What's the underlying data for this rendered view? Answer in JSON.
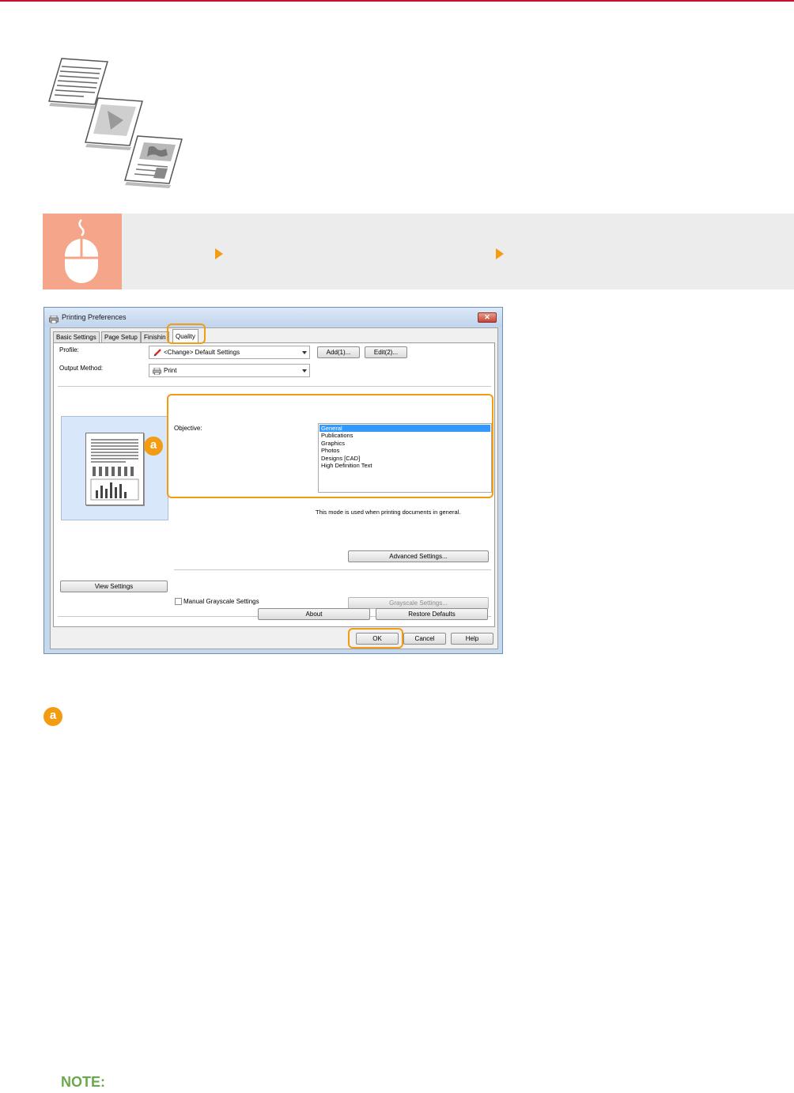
{
  "dialog": {
    "title": "Printing Preferences",
    "close_glyph": "✕",
    "tabs": [
      {
        "label": "Basic Settings"
      },
      {
        "label": "Page Setup"
      },
      {
        "label": "Finishin"
      },
      {
        "label": "Quality"
      }
    ],
    "profile": {
      "label": "Profile:",
      "value": "<Change> Default Settings",
      "add_button": "Add(1)...",
      "edit_button": "Edit(2)..."
    },
    "output_method": {
      "label": "Output Method:",
      "value": "Print"
    },
    "objective": {
      "label": "Objective:",
      "options": [
        "General",
        "Publications",
        "Graphics",
        "Photos",
        "Designs [CAD]",
        "High Definition Text"
      ],
      "selected": "General",
      "description": "This mode is used when printing documents in general."
    },
    "advanced_settings_button": "Advanced Settings...",
    "view_settings_button": "View Settings",
    "manual_grayscale_label": "Manual Grayscale Settings",
    "grayscale_settings_button": "Grayscale Settings...",
    "about_button": "About",
    "restore_defaults_button": "Restore Defaults",
    "ok_button": "OK",
    "cancel_button": "Cancel",
    "help_button": "Help"
  },
  "callout": {
    "letter": "a"
  },
  "legend": {
    "letter": "a"
  },
  "note": {
    "label": "NOTE:"
  },
  "colors": {
    "accent_orange": "#f39c12",
    "top_rule_red": "#c8102e",
    "mouse_box": "#f5a58a",
    "note_green": "#6aa84f",
    "selection_blue": "#3399ff"
  },
  "icons": [
    "document-stack-icon",
    "mouse-icon",
    "printer-icon",
    "pencil-icon"
  ]
}
